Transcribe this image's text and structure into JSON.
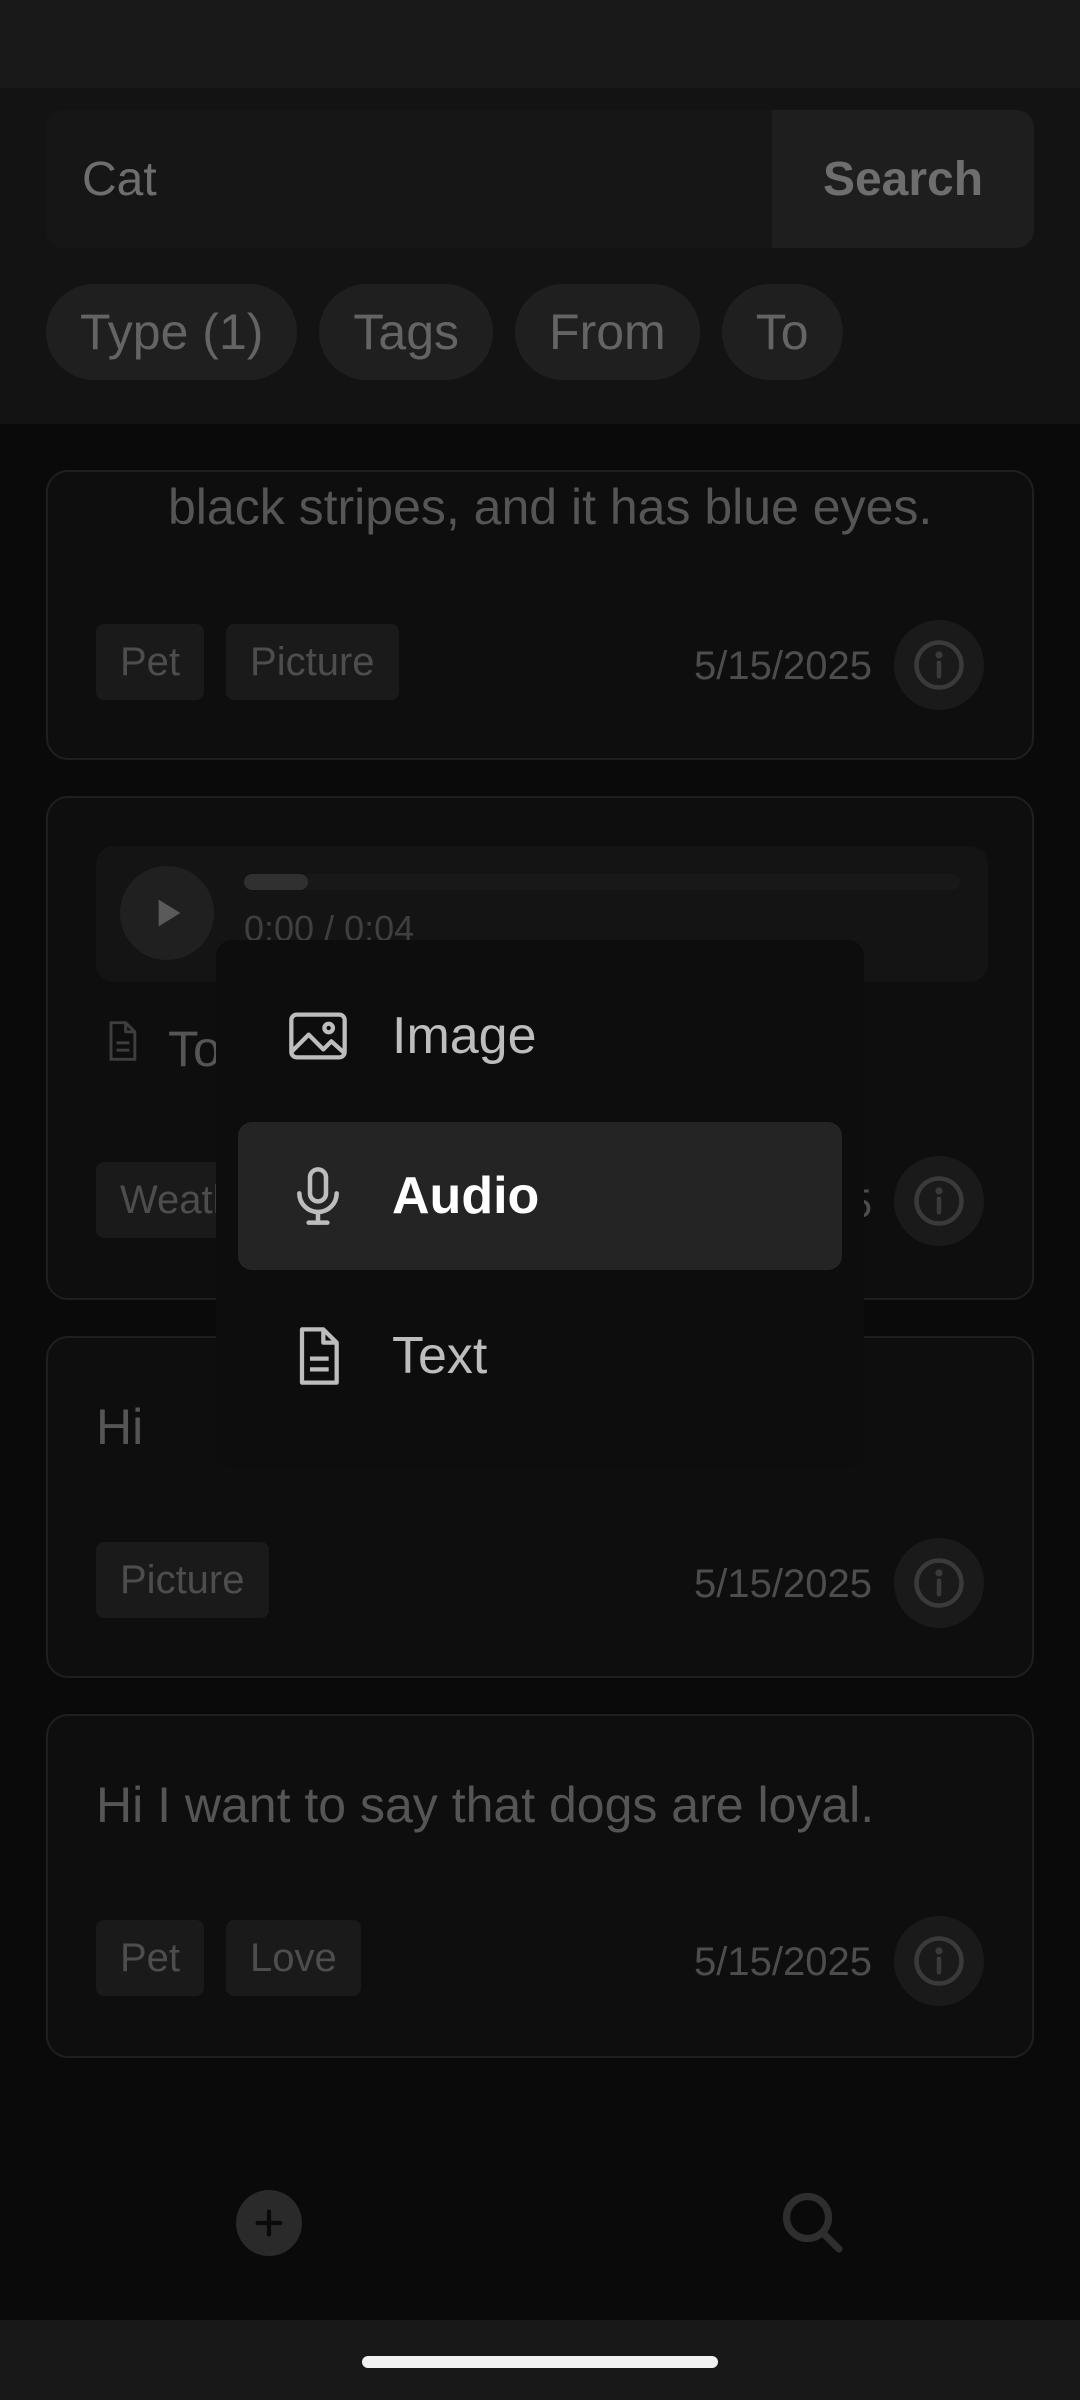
{
  "search": {
    "value": "Cat",
    "button_label": "Search"
  },
  "filters": [
    {
      "label": "Type (1)"
    },
    {
      "label": "Tags"
    },
    {
      "label": "From"
    },
    {
      "label": "To"
    }
  ],
  "cards": [
    {
      "text": "black stripes, and it has blue eyes.",
      "tags": [
        "Pet",
        "Picture"
      ],
      "date": "5/15/2025"
    },
    {
      "audio_time": "0:00 / 0:04",
      "audio_progress": 0.09,
      "text_fragment": "To",
      "tag_fragment": "Weatl",
      "date_fragment": "5"
    },
    {
      "text": "Hi",
      "tags": [
        "Picture"
      ],
      "date": "5/15/2025"
    },
    {
      "text": "Hi I want to say that dogs are loyal.",
      "tags": [
        "Pet",
        "Love"
      ],
      "date": "5/15/2025"
    }
  ],
  "type_menu": {
    "items": [
      {
        "label": "Image",
        "icon": "image-icon"
      },
      {
        "label": "Audio",
        "icon": "microphone-icon",
        "selected": true
      },
      {
        "label": "Text",
        "icon": "document-icon"
      }
    ]
  },
  "nav": {
    "add_icon": "plus-icon",
    "search_icon": "search-icon"
  },
  "colors": {
    "background": "#0a0a0a",
    "menu_selected": "#242424",
    "accent_text": "#ffffff"
  }
}
